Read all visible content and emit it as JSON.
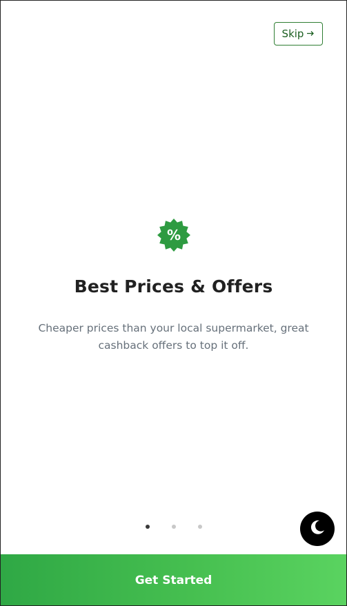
{
  "onboarding": {
    "skip_label": "Skip",
    "skip_icon": "arrow-right-icon",
    "slide": {
      "icon": "discount-badge-icon",
      "icon_text": "%",
      "title": "Best Prices & Offers",
      "description": "Cheaper prices than your local supermarket, great cashback offers to top it off."
    },
    "pagination": {
      "total": 3,
      "active_index": 0
    },
    "theme_toggle_icon": "moon-icon",
    "cta_label": "Get Started"
  },
  "colors": {
    "accent": "#2e9b41",
    "accent_light": "#5ad360",
    "title_text": "#212121",
    "body_text": "#66707a"
  }
}
